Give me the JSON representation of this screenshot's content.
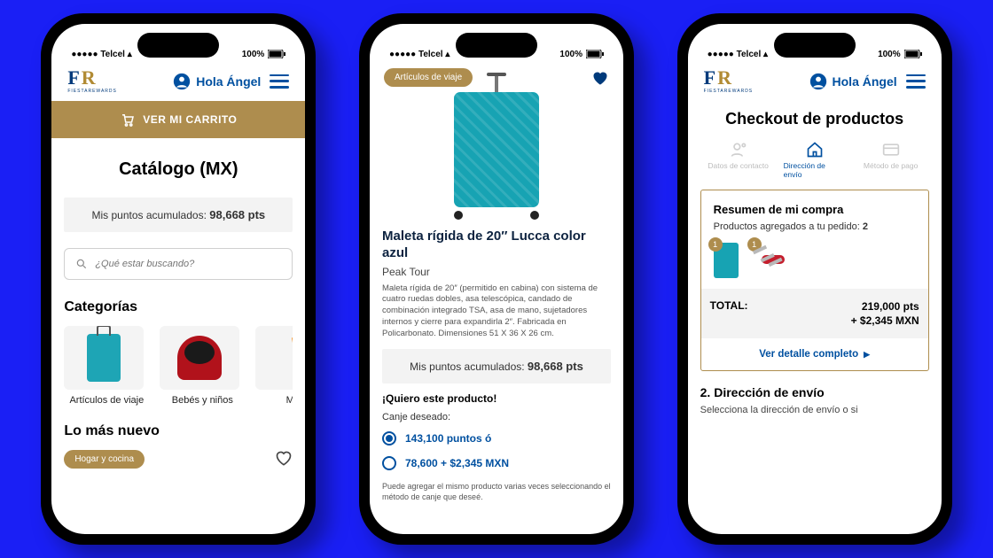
{
  "status": {
    "carrier": "Telcel",
    "battery": "100%"
  },
  "brand": {
    "name": "FIESTAREWARDS"
  },
  "user_greeting": "Hola Ángel",
  "colors": {
    "gold": "#ae8d4e",
    "blue": "#0050a0",
    "navy": "#003a7b",
    "teal": "#17a3b3"
  },
  "catalog": {
    "cart_button": "VER MI CARRITO",
    "title": "Catálogo (MX)",
    "points_label": "Mis puntos acumulados:",
    "points_value": "98,668 pts",
    "search_placeholder": "¿Qué estar buscando?",
    "categories_heading": "Categorías",
    "categories": [
      {
        "label": "Artículos de viaje"
      },
      {
        "label": "Bebés y niños"
      },
      {
        "label": "Mone"
      }
    ],
    "newest_heading": "Lo más nuevo",
    "newest_tag": "Hogar y cocina"
  },
  "product": {
    "tag": "Artículos de viaje",
    "title": "Maleta rígida de 20″ Lucca color azul",
    "brand": "Peak Tour",
    "description": "Maleta rígida de 20″ (permitido en cabina) con sistema de cuatro ruedas dobles, asa telescópica, candado de combinación integrado TSA, asa de mano, sujetadores internos y cierre para expandirla 2″. Fabricada en Policarbonato. Dimensiones 51 X 36 X 26 cm.",
    "points_label": "Mis puntos acumulados:",
    "points_value": "98,668 pts",
    "want_heading": "¡Quiero este producto!",
    "redeem_label": "Canje deseado:",
    "option_a": "143,100 puntos ó",
    "option_b": "78,600 + $2,345 MXN",
    "note": "Puede agregar el mismo producto varias veces seleccionando el método de canje que deseé."
  },
  "checkout": {
    "title": "Checkout de productos",
    "steps": [
      {
        "label": "Datos de contacto"
      },
      {
        "label": "Dirección de envío"
      },
      {
        "label": "Método de pago"
      }
    ],
    "active_step": 1,
    "summary_heading": "Resumen de mi compra",
    "summary_line": "Productos agregados a tu pedido:",
    "summary_count": "2",
    "items": [
      {
        "qty": "1"
      },
      {
        "qty": "1"
      }
    ],
    "total_label": "TOTAL:",
    "total_points": "219,000 pts",
    "total_cash": "+ $2,345 MXN",
    "detail_link": "Ver detalle completo",
    "section2_heading": "2. Dirección de envío",
    "section2_body": "Selecciona la dirección de envío o si"
  }
}
